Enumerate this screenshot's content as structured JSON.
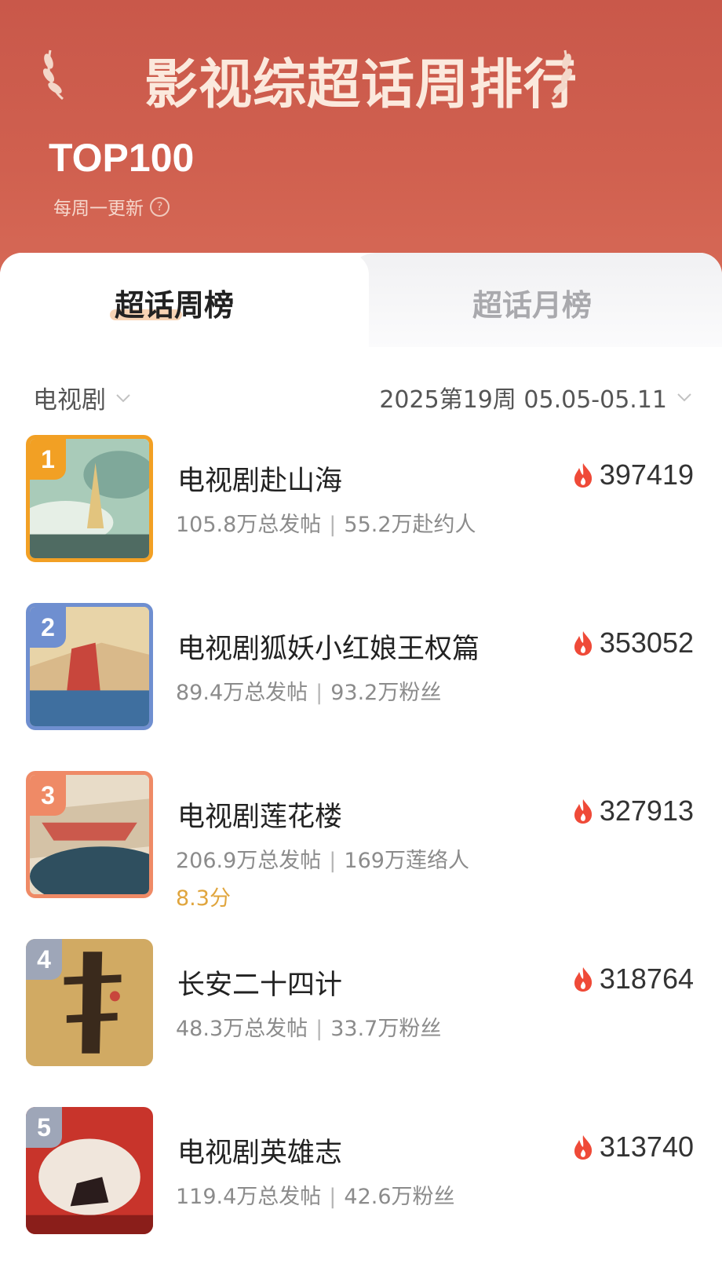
{
  "header": {
    "title": "影视综超话周排行",
    "subtitle": "TOP100",
    "update_note": "每周一更新",
    "help_icon": "help-circle-icon"
  },
  "tabs": [
    {
      "label": "超话周榜",
      "active": true
    },
    {
      "label": "超话月榜",
      "active": false
    }
  ],
  "filters": {
    "category": "电视剧",
    "period": "2025第19周 05.05-05.11"
  },
  "colors": {
    "header_bg": "#c9584a",
    "rank_1": "#f2a024",
    "rank_2": "#6f8fd0",
    "rank_3": "#ef8a66",
    "rank_other": "#9ea6b8",
    "heat_icon": "#ef4a38",
    "rating": "#e0a53d"
  },
  "rankings": [
    {
      "rank": "1",
      "name": "电视剧赴山海",
      "posts": "105.8万总发帖",
      "fans": "55.2万赴约人",
      "heat": "397419",
      "rating": ""
    },
    {
      "rank": "2",
      "name": "电视剧狐妖小红娘王权篇",
      "posts": "89.4万总发帖",
      "fans": "93.2万粉丝",
      "heat": "353052",
      "rating": ""
    },
    {
      "rank": "3",
      "name": "电视剧莲花楼",
      "posts": "206.9万总发帖",
      "fans": "169万莲络人",
      "heat": "327913",
      "rating": "8.3分"
    },
    {
      "rank": "4",
      "name": "长安二十四计",
      "posts": "48.3万总发帖",
      "fans": "33.7万粉丝",
      "heat": "318764",
      "rating": ""
    },
    {
      "rank": "5",
      "name": "电视剧英雄志",
      "posts": "119.4万总发帖",
      "fans": "42.6万粉丝",
      "heat": "313740",
      "rating": ""
    }
  ]
}
